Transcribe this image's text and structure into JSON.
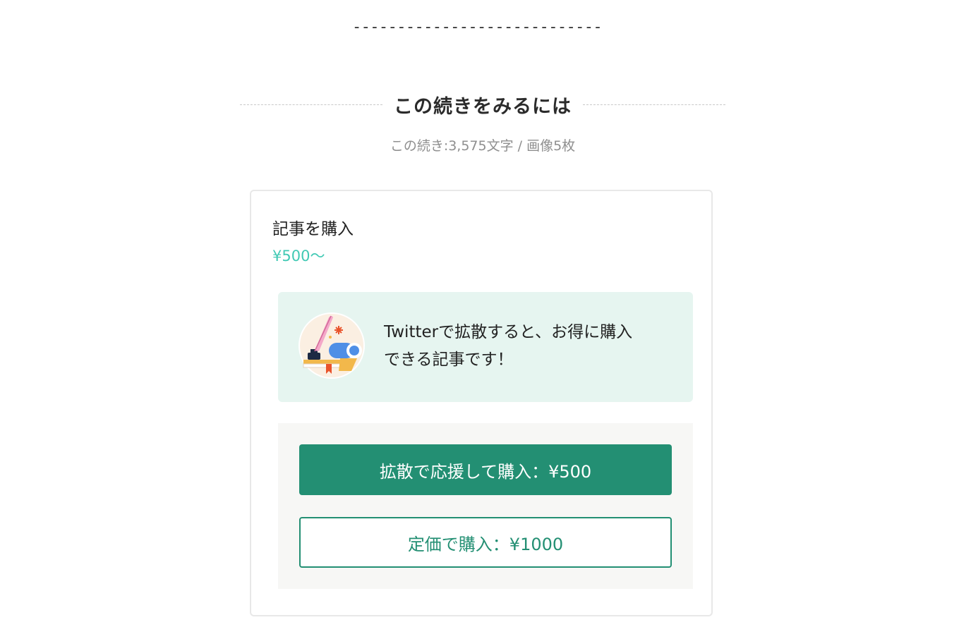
{
  "divider": {
    "text": "----------------------------"
  },
  "paywall": {
    "heading": "この続きをみるには",
    "subinfo": "この続き:3,575文字 / 画像5枚"
  },
  "purchase_card": {
    "title": "記事を購入",
    "price": "¥500〜",
    "promo": {
      "illustration_icon": "pen-and-book-illustration-icon",
      "line1": "Twitterで拡散すると、お得に購入",
      "line2": "できる記事です！"
    },
    "buttons": {
      "share_purchase_label": "拡散で応援して購入：¥500",
      "regular_purchase_label": "定価で購入：¥1000"
    }
  },
  "colors": {
    "accent_green": "#238f73",
    "price_teal": "#41c9b4",
    "promo_bg": "#e6f5f0",
    "button_area_bg": "#f7f7f5"
  }
}
